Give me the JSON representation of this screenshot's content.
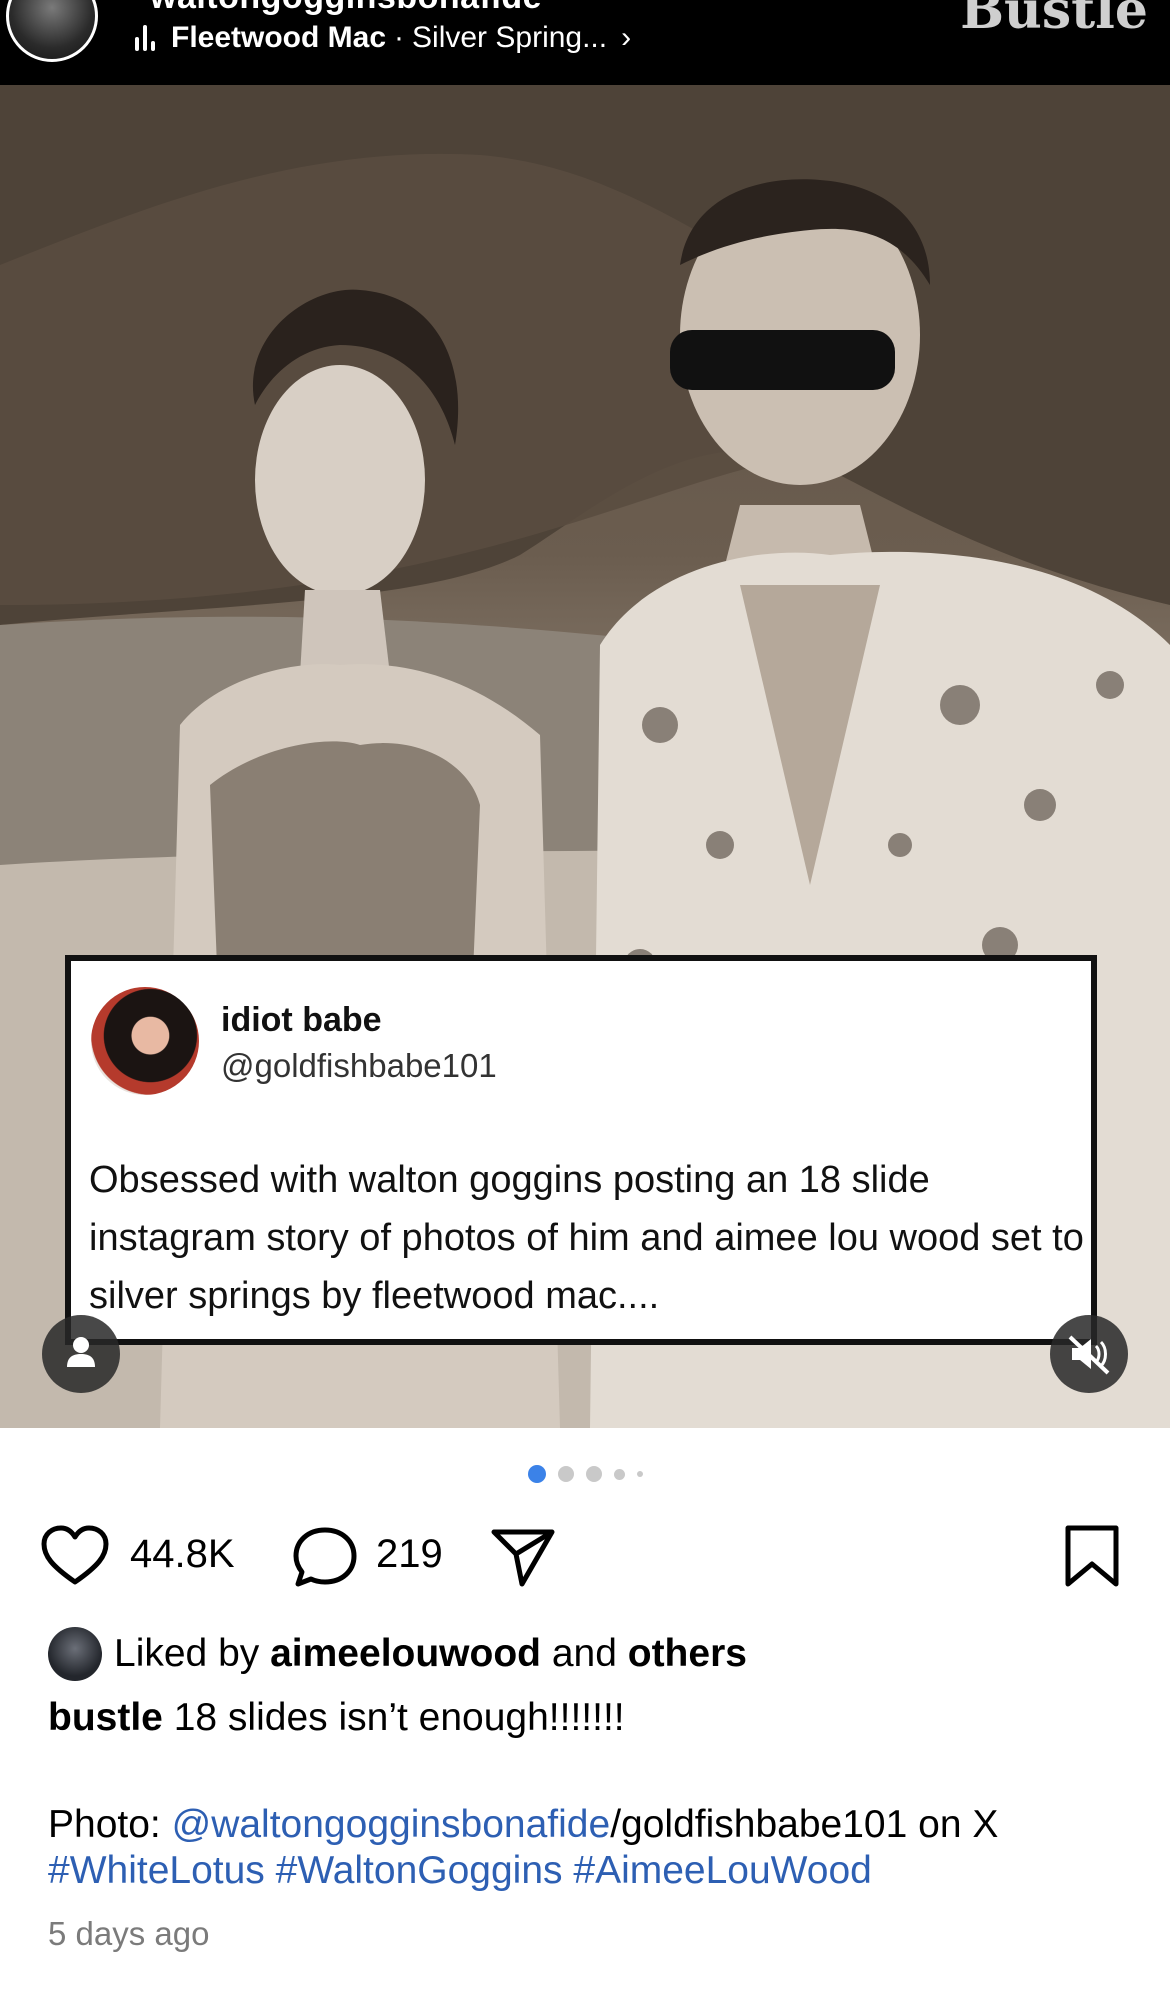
{
  "header": {
    "account_username": "waltongogginsbonafide",
    "music_artist": "Fleetwood Mac",
    "music_separator": "·",
    "music_title": "Silver Spring...",
    "chevron": "›",
    "brand_watermark": "Bustle"
  },
  "tweet": {
    "display_name": "idiot babe",
    "handle": "@goldfishbabe101",
    "text": "Obsessed with walton goggins posting an 18 slide instagram story of photos of him and aimee lou wood set to silver springs by fleetwood mac...."
  },
  "carousel": {
    "total_dots": 5,
    "active_index": 0,
    "active_color": "#3b82e8"
  },
  "actions": {
    "likes_count": "44.8K",
    "comments_count": "219",
    "icons": [
      "heart-icon",
      "comment-icon",
      "share-icon",
      "bookmark-icon"
    ]
  },
  "caption": {
    "liked_prefix": "Liked by",
    "liked_user": "aimeelouwood",
    "liked_and": "and",
    "liked_others": "others",
    "author": "bustle",
    "text": "18 slides isn’t enough!!!!!!!",
    "photo_label": "Photo:",
    "photo_mention": "@waltongogginsbonafide",
    "photo_rest": "/goldfishbabe101 on X",
    "hashtags": [
      "#WhiteLotus",
      "#WaltonGoggins",
      "#AimeeLouWood"
    ],
    "timestamp": "5 days ago"
  },
  "colors": {
    "link": "#2d5fb3",
    "header_bg": "#000000",
    "muted_text": "#7b7b7b"
  }
}
